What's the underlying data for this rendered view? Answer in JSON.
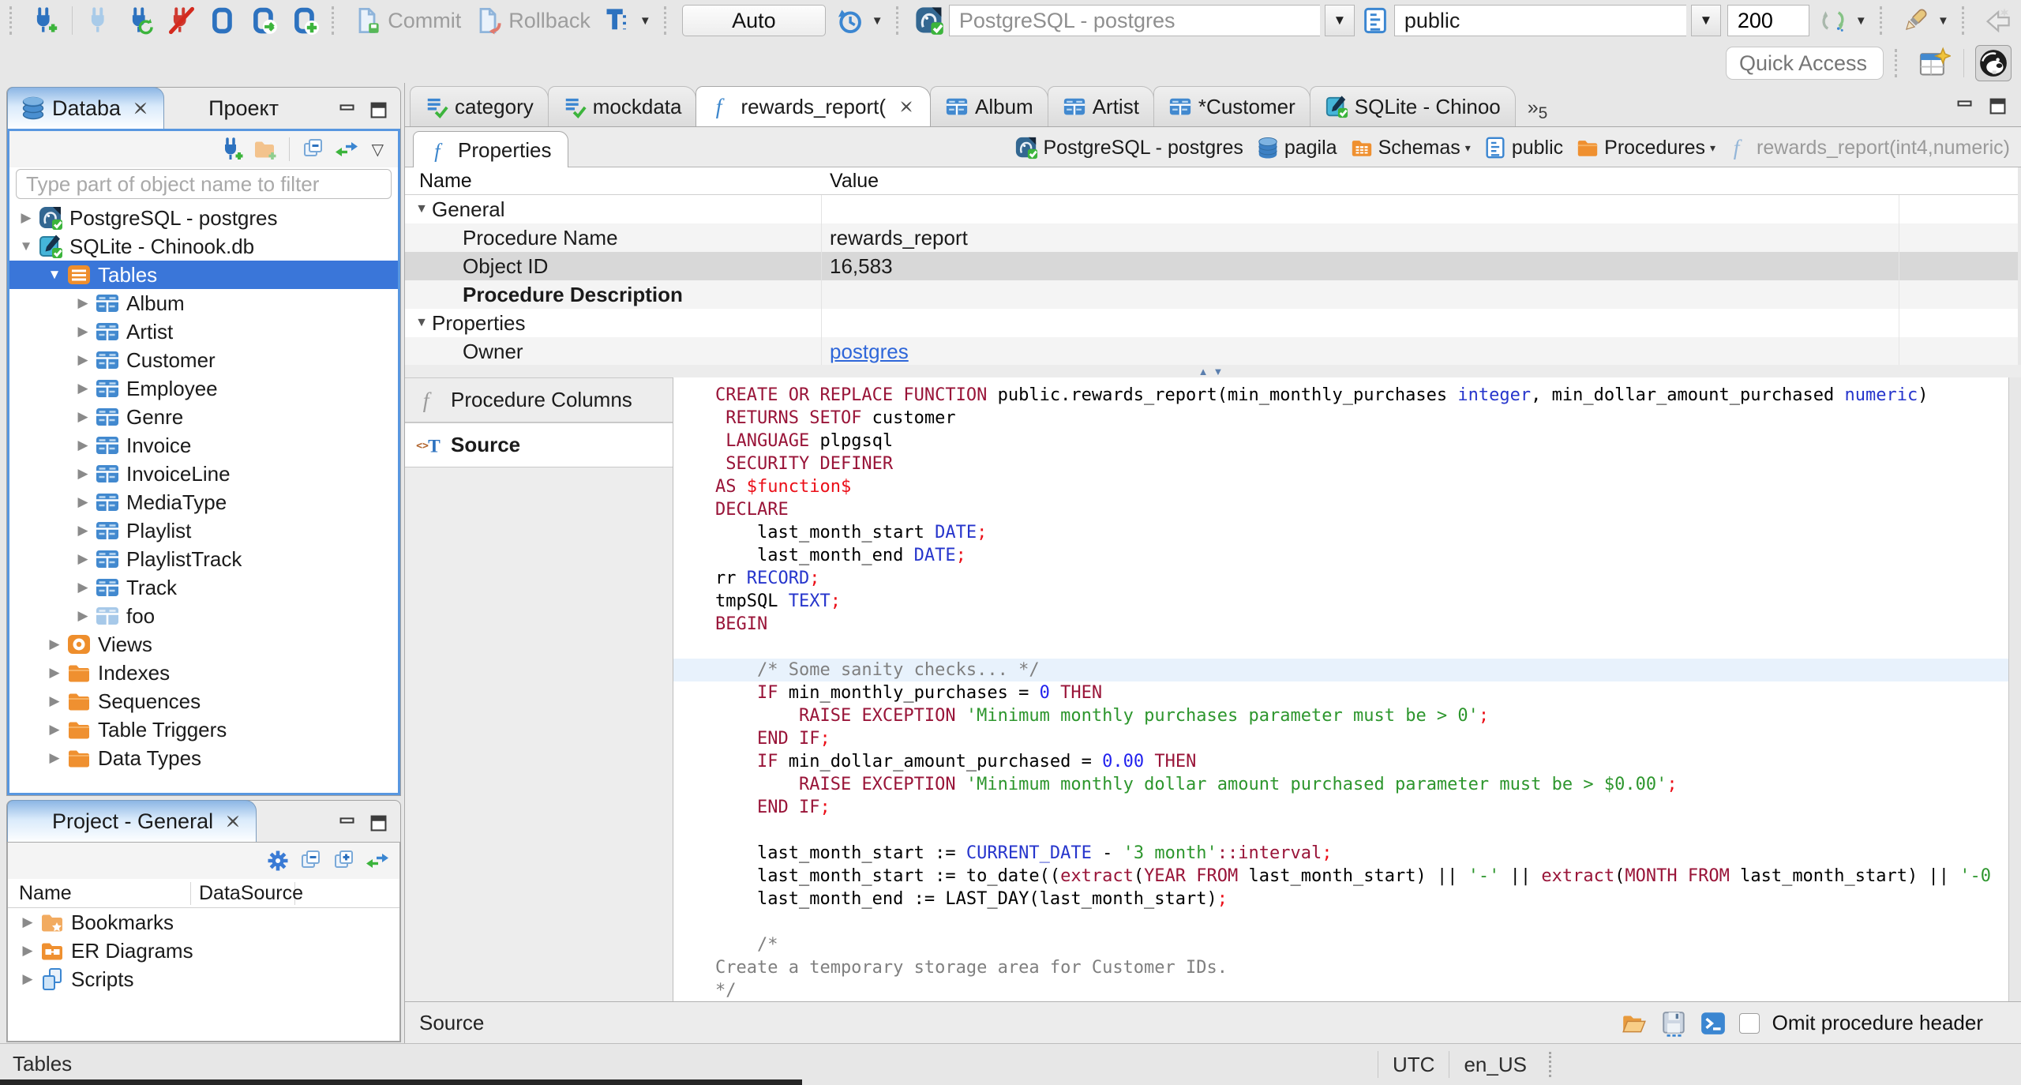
{
  "window": {
    "quick_access_placeholder": "Quick Access",
    "status_left": "Tables",
    "status_timezone": "UTC",
    "status_locale": "en_US"
  },
  "toolbar": {
    "commit_label": "Commit",
    "rollback_label": "Rollback",
    "auto_label": "Auto",
    "connection_combo": "PostgreSQL - postgres",
    "schema_combo": "public",
    "fetch_size": "200"
  },
  "navigator": {
    "tabs": [
      {
        "label": "Databa",
        "icon": "db-stack",
        "active": true,
        "closable": true
      },
      {
        "label": "Проект",
        "icon": "window-blue",
        "active": false,
        "closable": false
      }
    ],
    "filter_placeholder": "Type part of object name to filter",
    "tree": [
      {
        "label": "PostgreSQL - postgres",
        "icon": "postgres",
        "level": 0,
        "arrow": "collapsed"
      },
      {
        "label": "SQLite - Chinook.db",
        "icon": "sqlite",
        "level": 0,
        "arrow": "expanded"
      },
      {
        "label": "Tables",
        "icon": "folder-tables",
        "level": 1,
        "arrow": "expanded",
        "selected": true
      },
      {
        "label": "Album",
        "icon": "table",
        "level": 2,
        "arrow": "collapsed"
      },
      {
        "label": "Artist",
        "icon": "table",
        "level": 2,
        "arrow": "collapsed"
      },
      {
        "label": "Customer",
        "icon": "table",
        "level": 2,
        "arrow": "collapsed"
      },
      {
        "label": "Employee",
        "icon": "table",
        "level": 2,
        "arrow": "collapsed"
      },
      {
        "label": "Genre",
        "icon": "table",
        "level": 2,
        "arrow": "collapsed"
      },
      {
        "label": "Invoice",
        "icon": "table",
        "level": 2,
        "arrow": "collapsed"
      },
      {
        "label": "InvoiceLine",
        "icon": "table",
        "level": 2,
        "arrow": "collapsed"
      },
      {
        "label": "MediaType",
        "icon": "table",
        "level": 2,
        "arrow": "collapsed"
      },
      {
        "label": "Playlist",
        "icon": "table",
        "level": 2,
        "arrow": "collapsed"
      },
      {
        "label": "PlaylistTrack",
        "icon": "table",
        "level": 2,
        "arrow": "collapsed"
      },
      {
        "label": "Track",
        "icon": "table",
        "level": 2,
        "arrow": "collapsed"
      },
      {
        "label": "foo",
        "icon": "table-light",
        "level": 2,
        "arrow": "collapsed"
      },
      {
        "label": "Views",
        "icon": "views-eye",
        "level": 1,
        "arrow": "collapsed"
      },
      {
        "label": "Indexes",
        "icon": "folder",
        "level": 1,
        "arrow": "collapsed"
      },
      {
        "label": "Sequences",
        "icon": "folder",
        "level": 1,
        "arrow": "collapsed"
      },
      {
        "label": "Table Triggers",
        "icon": "folder",
        "level": 1,
        "arrow": "collapsed"
      },
      {
        "label": "Data Types",
        "icon": "folder",
        "level": 1,
        "arrow": "collapsed"
      }
    ]
  },
  "project_panel": {
    "tab_label": "Project - General",
    "columns": [
      "Name",
      "DataSource"
    ],
    "rows": [
      {
        "label": "Bookmarks",
        "icon": "folder-bookmarks"
      },
      {
        "label": "ER Diagrams",
        "icon": "folder-er"
      },
      {
        "label": "Scripts",
        "icon": "scripts"
      }
    ]
  },
  "editor": {
    "tabs": [
      {
        "label": "category",
        "icon": "script-check"
      },
      {
        "label": "mockdata",
        "icon": "script-check"
      },
      {
        "label": "rewards_report(",
        "icon": "func-f",
        "active": true,
        "closable": true
      },
      {
        "label": "Album",
        "icon": "table"
      },
      {
        "label": "Artist",
        "icon": "table"
      },
      {
        "label": "*Customer",
        "icon": "table"
      },
      {
        "label": "SQLite - Chinoo",
        "icon": "sqlite"
      }
    ],
    "overflow_count": "5",
    "properties_tab_label": "Properties",
    "breadcrumb": [
      {
        "label": "PostgreSQL - postgres",
        "icon": "postgres"
      },
      {
        "label": "pagila",
        "icon": "db-cyl"
      },
      {
        "label": "Schemas",
        "icon": "folder-schemas",
        "dropdown": true
      },
      {
        "label": "public",
        "icon": "schema-doc"
      },
      {
        "label": "Procedures",
        "icon": "folder",
        "dropdown": true
      },
      {
        "label": "rewards_report(int4,numeric)",
        "icon": "func-pale",
        "muted": true
      }
    ],
    "grid": {
      "columns": [
        "Name",
        "Value"
      ],
      "rows": [
        {
          "name": "General",
          "value": "",
          "group": true
        },
        {
          "name": "Procedure Name",
          "value": "rewards_report"
        },
        {
          "name": "Object ID",
          "value": "16,583",
          "selected": true
        },
        {
          "name": "Procedure Description",
          "value": "",
          "bold": true
        },
        {
          "name": "Properties",
          "value": "",
          "group": true
        },
        {
          "name": "Owner",
          "value": "postgres",
          "link": true
        }
      ]
    },
    "subtabs": [
      {
        "label": "Procedure Columns",
        "icon": "func-gray"
      },
      {
        "label": "Source",
        "icon": "source-ic",
        "active": true
      }
    ],
    "statusbar": {
      "left": "Source",
      "checkbox_label": "Omit procedure header"
    }
  },
  "source_code": {
    "highlight_line": 12,
    "lines": [
      [
        [
          "kw",
          "CREATE OR REPLACE FUNCTION"
        ],
        [
          "pl",
          " public.rewards_report(min_monthly_purchases "
        ],
        [
          "ty",
          "integer"
        ],
        [
          "pl",
          ", min_dollar_amount_purchased "
        ],
        [
          "ty",
          "numeric"
        ],
        [
          "pl",
          ")"
        ]
      ],
      [
        [
          "pl",
          " "
        ],
        [
          "kw",
          "RETURNS SETOF"
        ],
        [
          "pl",
          " customer"
        ]
      ],
      [
        [
          "pl",
          " "
        ],
        [
          "kw",
          "LANGUAGE"
        ],
        [
          "pl",
          " plpgsql"
        ]
      ],
      [
        [
          "pl",
          " "
        ],
        [
          "kw",
          "SECURITY DEFINER"
        ]
      ],
      [
        [
          "kw",
          "AS"
        ],
        [
          "pl",
          " "
        ],
        [
          "red",
          "$function$"
        ]
      ],
      [
        [
          "kw",
          "DECLARE"
        ]
      ],
      [
        [
          "pl",
          "    last_month_start "
        ],
        [
          "ty",
          "DATE"
        ],
        [
          "red",
          ";"
        ]
      ],
      [
        [
          "pl",
          "    last_month_end "
        ],
        [
          "ty",
          "DATE"
        ],
        [
          "red",
          ";"
        ]
      ],
      [
        [
          "pl",
          "rr "
        ],
        [
          "ty",
          "RECORD"
        ],
        [
          "red",
          ";"
        ]
      ],
      [
        [
          "pl",
          "tmpSQL "
        ],
        [
          "ty",
          "TEXT"
        ],
        [
          "red",
          ";"
        ]
      ],
      [
        [
          "kw",
          "BEGIN"
        ]
      ],
      [],
      [
        [
          "cm",
          "    /* Some sanity checks... */"
        ]
      ],
      [
        [
          "pl",
          "    "
        ],
        [
          "kw",
          "IF"
        ],
        [
          "pl",
          " min_monthly_purchases = "
        ],
        [
          "num",
          "0"
        ],
        [
          "pl",
          " "
        ],
        [
          "kw",
          "THEN"
        ]
      ],
      [
        [
          "pl",
          "        "
        ],
        [
          "kw",
          "RAISE EXCEPTION"
        ],
        [
          "pl",
          " "
        ],
        [
          "str",
          "'Minimum monthly purchases parameter must be > 0'"
        ],
        [
          "red",
          ";"
        ]
      ],
      [
        [
          "pl",
          "    "
        ],
        [
          "kw",
          "END IF"
        ],
        [
          "red",
          ";"
        ]
      ],
      [
        [
          "pl",
          "    "
        ],
        [
          "kw",
          "IF"
        ],
        [
          "pl",
          " min_dollar_amount_purchased = "
        ],
        [
          "num",
          "0.00"
        ],
        [
          "pl",
          " "
        ],
        [
          "kw",
          "THEN"
        ]
      ],
      [
        [
          "pl",
          "        "
        ],
        [
          "kw",
          "RAISE EXCEPTION"
        ],
        [
          "pl",
          " "
        ],
        [
          "str",
          "'Minimum monthly dollar amount purchased parameter must be > $0.00'"
        ],
        [
          "red",
          ";"
        ]
      ],
      [
        [
          "pl",
          "    "
        ],
        [
          "kw",
          "END IF"
        ],
        [
          "red",
          ";"
        ]
      ],
      [],
      [
        [
          "pl",
          "    last_month_start := "
        ],
        [
          "ty",
          "CURRENT_DATE"
        ],
        [
          "pl",
          " - "
        ],
        [
          "str",
          "'3 month'"
        ],
        [
          "kw",
          "::interval"
        ],
        [
          "red",
          ";"
        ]
      ],
      [
        [
          "pl",
          "    last_month_start := to_date(("
        ],
        [
          "kw",
          "extract"
        ],
        [
          "pl",
          "("
        ],
        [
          "kw",
          "YEAR FROM"
        ],
        [
          "pl",
          " last_month_start) || "
        ],
        [
          "str",
          "'-'"
        ],
        [
          "pl",
          " || "
        ],
        [
          "kw",
          "extract"
        ],
        [
          "pl",
          "("
        ],
        [
          "kw",
          "MONTH FROM"
        ],
        [
          "pl",
          " last_month_start) || "
        ],
        [
          "str",
          "'-0"
        ]
      ],
      [
        [
          "pl",
          "    last_month_end := LAST_DAY(last_month_start)"
        ],
        [
          "red",
          ";"
        ]
      ],
      [],
      [
        [
          "cm",
          "    /*"
        ]
      ],
      [
        [
          "cm",
          "Create a temporary storage area for Customer IDs."
        ]
      ],
      [
        [
          "cm",
          "*/"
        ]
      ]
    ]
  }
}
